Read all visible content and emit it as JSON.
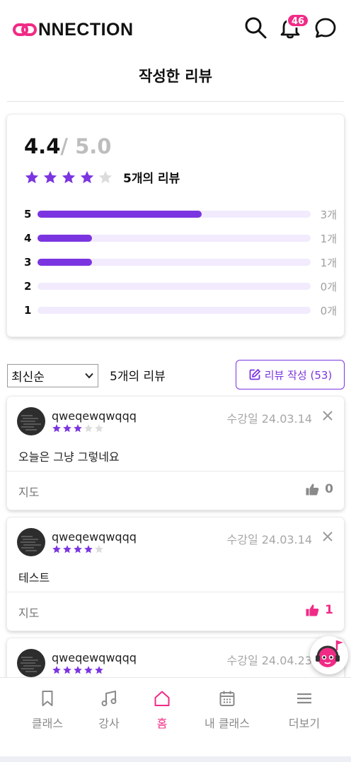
{
  "header": {
    "logo_text": "NNECTION",
    "notification_count": "46"
  },
  "page_title": "작성한 리뷰",
  "summary": {
    "average": "4.4",
    "max": "/ 5.0",
    "rating": 4.4,
    "review_count_label": "5개의 리뷰",
    "distribution": [
      {
        "star": "5",
        "count": "3개",
        "fraction": 0.6
      },
      {
        "star": "4",
        "count": "1개",
        "fraction": 0.2
      },
      {
        "star": "3",
        "count": "1개",
        "fraction": 0.2
      },
      {
        "star": "2",
        "count": "0개",
        "fraction": 0
      },
      {
        "star": "1",
        "count": "0개",
        "fraction": 0
      }
    ]
  },
  "controls": {
    "sort_selected": "최신순",
    "list_count": "5개의 리뷰",
    "write_button": "리뷰 작성 (53)"
  },
  "reviews": [
    {
      "user": "qweqewqwqqq",
      "stars": 3,
      "date": "수강일 24.03.14",
      "text": "오늘은 그냥 그렇네요",
      "course": "지도",
      "likes": "0",
      "liked": false
    },
    {
      "user": "qweqewqwqqq",
      "stars": 4,
      "date": "수강일 24.03.14",
      "text": "테스트",
      "course": "지도",
      "likes": "1",
      "liked": true
    },
    {
      "user": "qweqewqwqqq",
      "stars": 5,
      "date": "수강일 24.04.23",
      "text": "",
      "course": "",
      "likes": "",
      "liked": false
    }
  ],
  "nav": [
    {
      "label": "클래스",
      "icon": "bookmark-icon"
    },
    {
      "label": "강사",
      "icon": "music-note-icon"
    },
    {
      "label": "홈",
      "icon": "home-icon"
    },
    {
      "label": "내 클래스",
      "icon": "calendar-icon"
    },
    {
      "label": "더보기",
      "icon": "menu-icon"
    }
  ],
  "colors": {
    "accent_purple": "#7b35e0",
    "accent_pink": "#f02b86",
    "bar_track": "#f1ebfd",
    "muted_text": "#9e9e9e"
  }
}
